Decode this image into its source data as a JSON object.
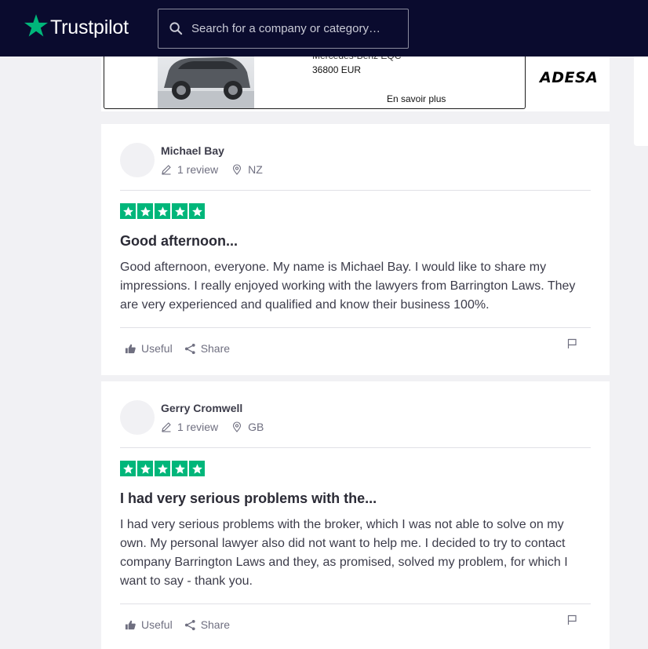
{
  "header": {
    "logo_text": "Trustpilot",
    "search_placeholder": "Search for a company or category…"
  },
  "ad": {
    "title": "Mercedes-Benz EQC",
    "price": "36800 EUR",
    "link": "En savoir plus",
    "brand": "ADESA"
  },
  "reviews": [
    {
      "name": "Michael Bay",
      "review_count": "1 review",
      "country": "NZ",
      "rating": 5,
      "title": "Good afternoon...",
      "body": "Good afternoon, everyone. My name is Michael Bay. I would like to share my impressions. I really enjoyed working with the lawyers from Barrington Laws. They are very experienced and qualified and know their business 100%.",
      "useful_label": "Useful",
      "share_label": "Share"
    },
    {
      "name": "Gerry Cromwell",
      "review_count": "1 review",
      "country": "GB",
      "rating": 5,
      "title": "I had very serious problems with the...",
      "body": "I had very serious problems with the broker, which I was not able to solve on my own. My personal lawyer also did not want to help me. I decided to try to contact company Barrington Laws and they, as promised, solved my problem, for which I want to say - thank you.",
      "useful_label": "Useful",
      "share_label": "Share"
    }
  ],
  "colors": {
    "header_bg": "#0a0b2e",
    "brand_green": "#00b67a",
    "page_bg": "#f1f1f4"
  }
}
